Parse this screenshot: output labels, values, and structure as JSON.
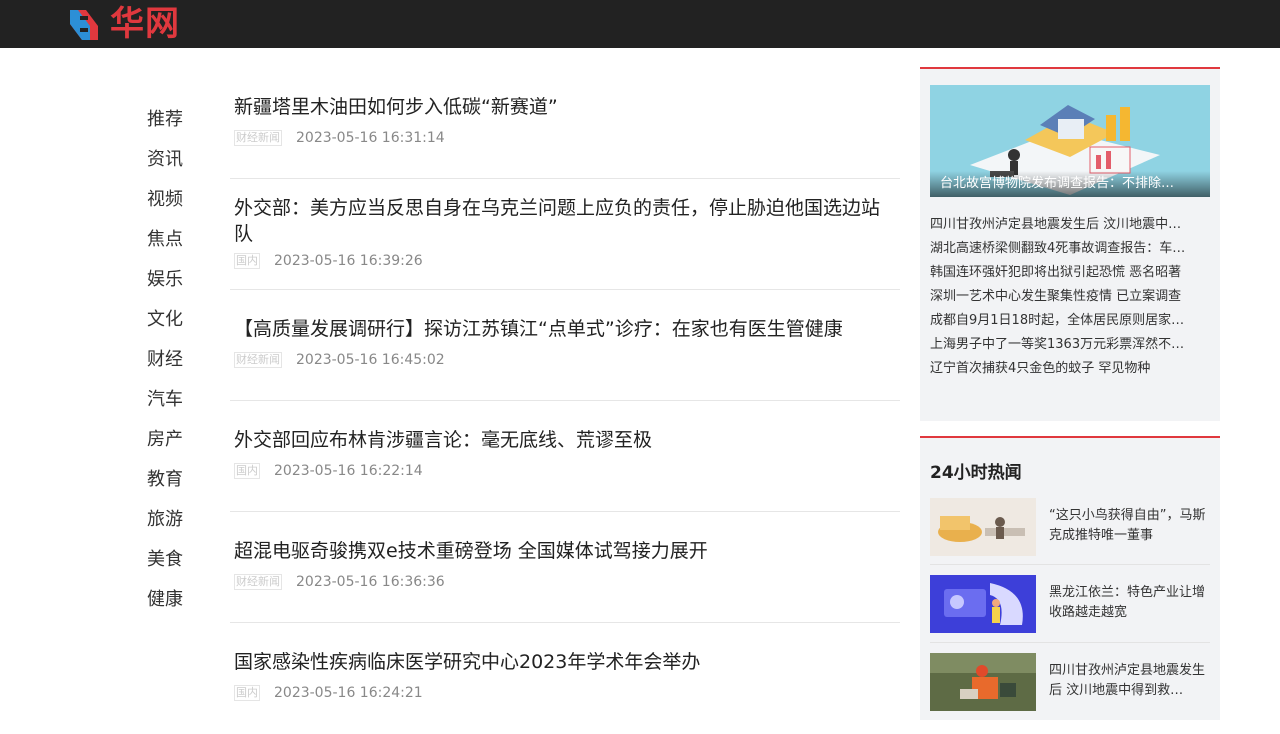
{
  "header": {
    "logo_text": "华网",
    "logo_icon": "s-logo-icon"
  },
  "nav": [
    "推荐",
    "资讯",
    "视频",
    "焦点",
    "娱乐",
    "文化",
    "财经",
    "汽车",
    "房产",
    "教育",
    "旅游",
    "美食",
    "健康"
  ],
  "news": [
    {
      "title": "新疆塔里木油田如何步入低碳“新赛道”",
      "tag": "财经新闻",
      "time": "2023-05-16 16:31:14"
    },
    {
      "title": "外交部：美方应当反思自身在乌克兰问题上应负的责任，停止胁迫他国选边站队",
      "tag": "国内",
      "time": "2023-05-16 16:39:26"
    },
    {
      "title": "【高质量发展调研行】探访江苏镇江“点单式”诊疗：在家也有医生管健康",
      "tag": "财经新闻",
      "time": "2023-05-16 16:45:02"
    },
    {
      "title": "外交部回应布林肯涉疆言论：毫无底线、荒谬至极",
      "tag": "国内",
      "time": "2023-05-16 16:22:14"
    },
    {
      "title": "超混电驱奇骏携双e技术重磅登场 全国媒体试驾接力展开",
      "tag": "财经新闻",
      "time": "2023-05-16 16:36:36"
    },
    {
      "title": "国家感染性疾病临床医学研究中心2023年学术年会举办",
      "tag": "国内",
      "time": "2023-05-16 16:24:21"
    }
  ],
  "side": {
    "hero_caption": "台北故宫博物院发布调查报告：不排除…",
    "links": [
      "四川甘孜州泸定县地震发生后 汶川地震中…",
      "湖北高速桥梁侧翻致4死事故调查报告：车…",
      "韩国连环强奸犯即将出狱引起恐慌 恶名昭著",
      "深圳一艺术中心发生聚集性疫情 已立案调查",
      "成都自9月1日18时起，全体居民原则居家…",
      "上海男子中了一等奖1363万元彩票浑然不…",
      "辽宁首次捕获4只金色的蚊子 罕见物种"
    ]
  },
  "hot": {
    "title": "24小时热闻",
    "items": [
      {
        "text": "“这只小鸟获得自由”，马斯克成推特唯一董事"
      },
      {
        "text": "黑龙江依兰：特色产业让增收路越走越宽"
      },
      {
        "text": "四川甘孜州泸定县地震发生后 汶川地震中得到救…"
      }
    ]
  },
  "colors": {
    "accent": "#e0383e",
    "header_bg": "#222222",
    "side_bg": "#f2f3f5"
  }
}
